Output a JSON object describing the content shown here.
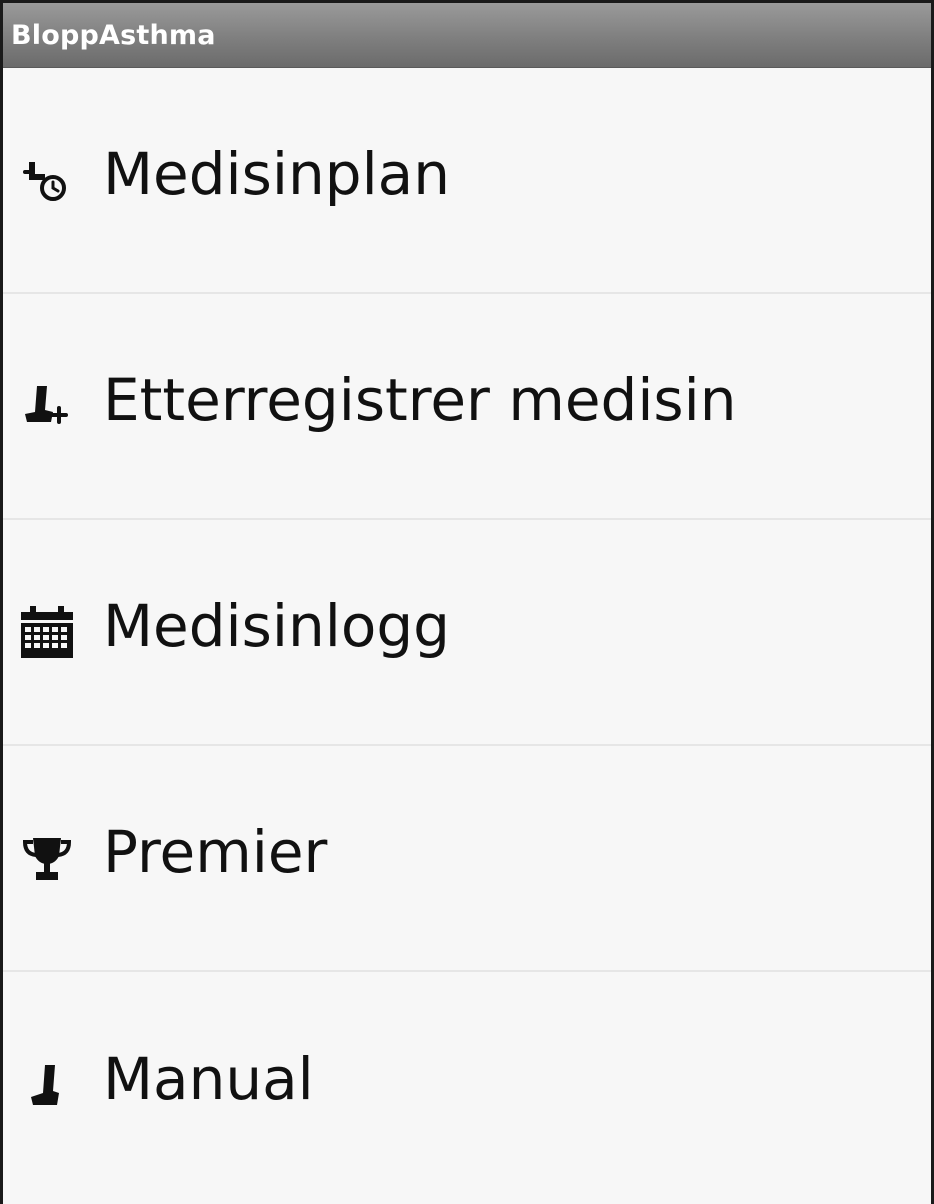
{
  "app": {
    "title": "BloppAsthma"
  },
  "menu": {
    "items": [
      {
        "label": "Medisinplan",
        "icon": "inhaler-clock-icon"
      },
      {
        "label": "Etterregistrer medisin",
        "icon": "inhaler-plus-icon"
      },
      {
        "label": "Medisinlogg",
        "icon": "calendar-icon"
      },
      {
        "label": "Premier",
        "icon": "trophy-icon"
      },
      {
        "label": "Manual",
        "icon": "inhaler-icon"
      }
    ]
  },
  "colors": {
    "titlebar": "#7f7f7f",
    "background": "#f7f7f7",
    "divider": "#e6e6e6",
    "text": "#111111"
  }
}
